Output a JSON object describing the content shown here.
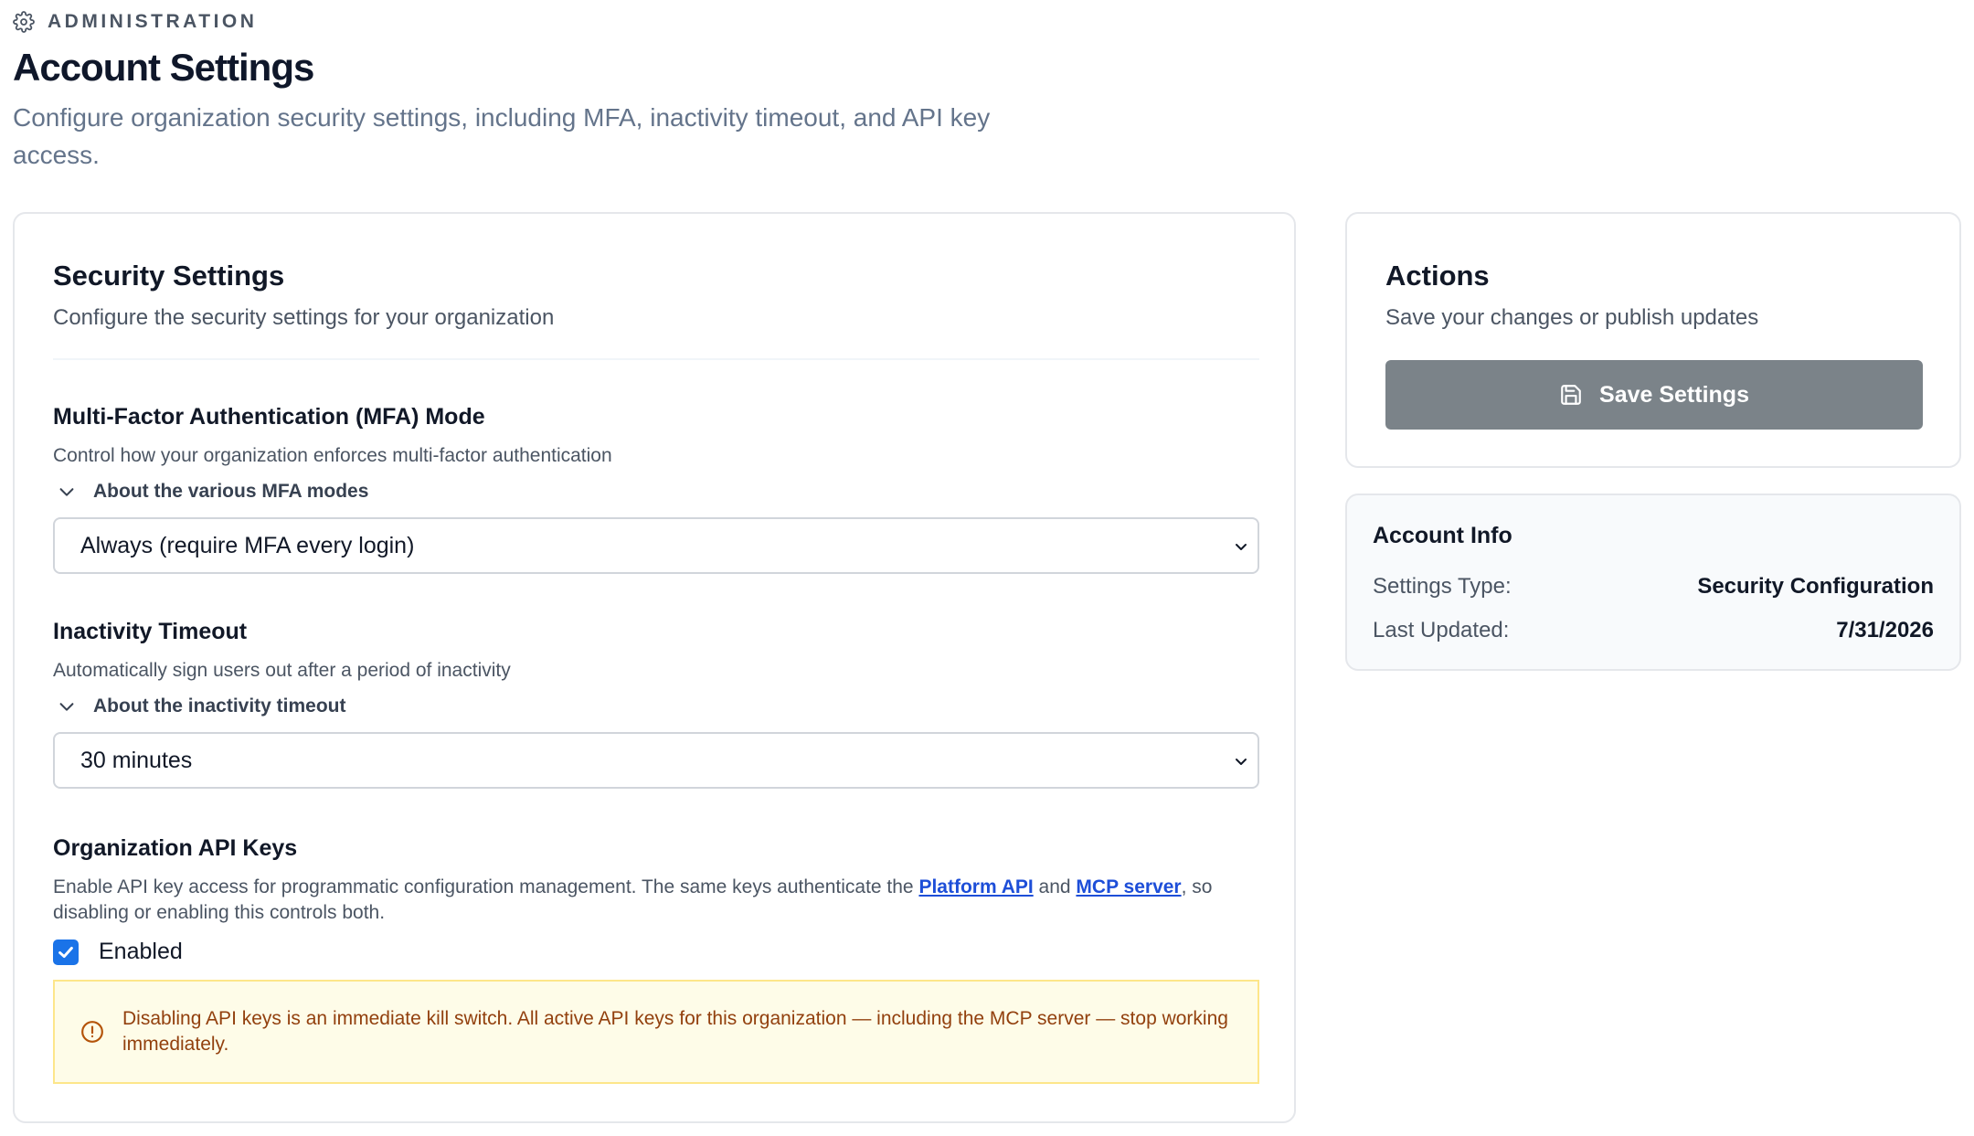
{
  "header": {
    "eyebrow": "ADMINISTRATION",
    "title": "Account Settings",
    "description": "Configure organization security settings, including MFA, inactivity timeout, and API key access."
  },
  "security": {
    "title": "Security Settings",
    "subtitle": "Configure the security settings for your organization",
    "mfa": {
      "title": "Multi-Factor Authentication (MFA) Mode",
      "description": "Control how your organization enforces multi-factor authentication",
      "disclosure": "About the various MFA modes",
      "selected": "Always (require MFA every login)"
    },
    "timeout": {
      "title": "Inactivity Timeout",
      "description": "Automatically sign users out after a period of inactivity",
      "disclosure": "About the inactivity timeout",
      "selected": "30 minutes"
    },
    "api": {
      "title": "Organization API Keys",
      "desc_part1": "Enable API key access for programmatic configuration management. The same keys authenticate the ",
      "link_platform": "Platform API",
      "desc_and": " and ",
      "link_mcp": "MCP server",
      "desc_part2": ", so disabling or enabling this controls both.",
      "checkbox_label": "Enabled",
      "checked": true,
      "warning": "Disabling API keys is an immediate kill switch. All active API keys for this organization — including the MCP server — stop working immediately."
    }
  },
  "actions": {
    "title": "Actions",
    "subtitle": "Save your changes or publish updates",
    "save_label": "Save Settings"
  },
  "account_info": {
    "title": "Account Info",
    "rows": [
      {
        "label": "Settings Type:",
        "value": "Security Configuration"
      },
      {
        "label": "Last Updated:",
        "value": "7/31/2026"
      }
    ]
  },
  "colors": {
    "primary_checkbox": "#1a73e8",
    "save_button": "#7b8389",
    "warning_bg": "#fefce8",
    "warning_text": "#92400e",
    "link": "#1d4ed8"
  },
  "icons": [
    "gear-icon",
    "chevron-down-icon",
    "save-icon",
    "check-icon",
    "alert-circle-icon"
  ]
}
